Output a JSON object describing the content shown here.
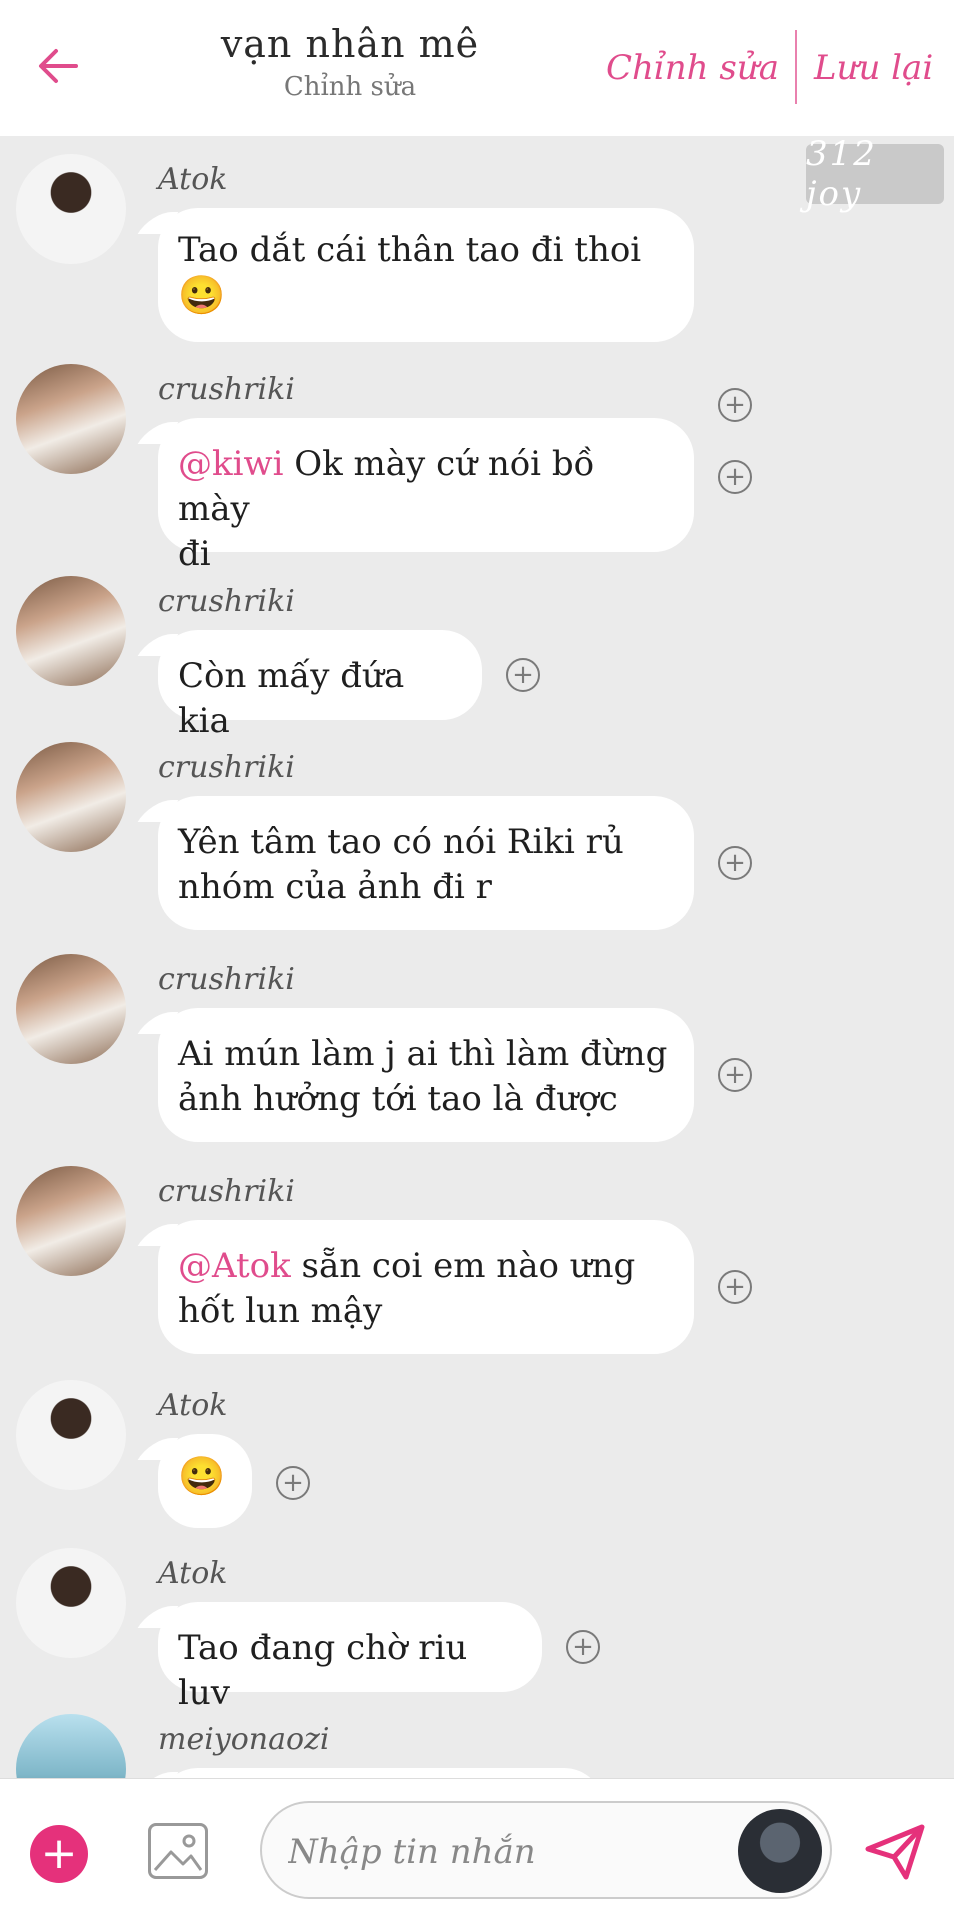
{
  "header": {
    "title": "vạn nhân mê",
    "subtitle": "Chỉnh sửa",
    "action_edit": "Chỉnh sửa",
    "action_save": "Lưu lại"
  },
  "badge": "312 joy",
  "messages": [
    {
      "user": "Atok",
      "parts": [
        "Tao dắt cái thân tao đi thoi",
        "😀"
      ]
    },
    {
      "user": "crushriki",
      "mention": "@kiwi",
      "text_line1": " Ok mày cứ nói bồ mày",
      "text_line2": "đi"
    },
    {
      "user": "crushriki",
      "text": "Còn mấy đứa kia"
    },
    {
      "user": "crushriki",
      "text_line1": "Yên tâm tao có nói Riki rủ",
      "text_line2": "nhóm của ảnh đi r"
    },
    {
      "user": "crushriki",
      "text_line1": "Ai mún làm j ai thì làm đừng",
      "text_line2": "ảnh hưởng tới tao là được"
    },
    {
      "user": "crushriki",
      "mention": "@Atok",
      "text_line1": " sẵn coi em nào ưng",
      "text_line2": "hốt lun mậy"
    },
    {
      "user": "Atok",
      "text": "😀"
    },
    {
      "user": "Atok",
      "text": "Tao đang chờ riu luv"
    },
    {
      "user": "meiyonaozi",
      "text": ""
    }
  ],
  "input": {
    "placeholder": "Nhập tin nhắn"
  },
  "colors": {
    "accent": "#e04c8c",
    "background": "#ebebeb"
  },
  "icons": {
    "back": "arrow-left-icon",
    "add": "plus-circle-icon",
    "image": "image-icon",
    "send": "paper-plane-icon"
  }
}
